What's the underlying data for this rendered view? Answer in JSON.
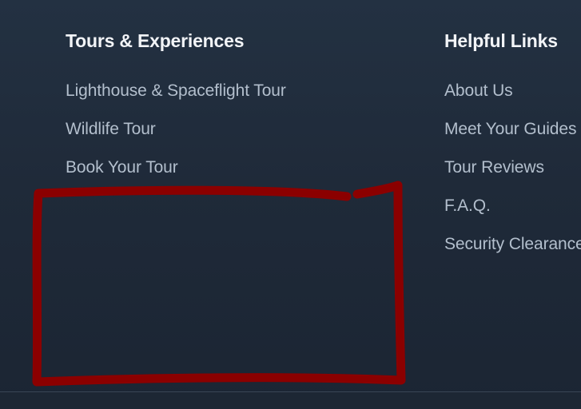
{
  "footer": {
    "tours": {
      "title": "Tours & Experiences",
      "items": [
        {
          "label": "Lighthouse & Spaceflight Tour"
        },
        {
          "label": "Wildlife Tour"
        },
        {
          "label": "Book Your Tour"
        }
      ]
    },
    "helpful_links": {
      "title": "Helpful Links",
      "items": [
        {
          "label": "About Us"
        },
        {
          "label": "Meet Your Guides"
        },
        {
          "label": "Tour Reviews"
        },
        {
          "label": "F.A.Q."
        },
        {
          "label": "Security Clearance"
        }
      ]
    }
  },
  "annotation": {
    "shape": "hand-drawn rectangle",
    "color": "#8b0000"
  }
}
